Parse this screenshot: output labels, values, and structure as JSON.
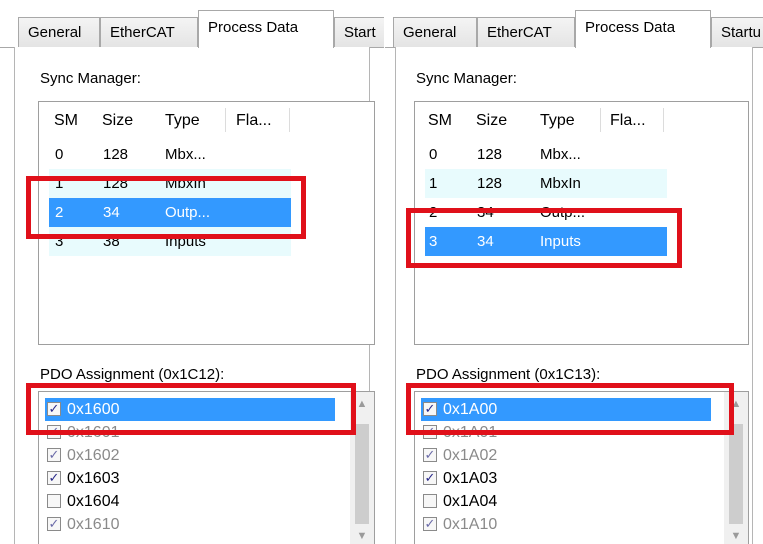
{
  "tabs": [
    "General",
    "EtherCAT",
    "Process Data",
    "Start",
    "Startu"
  ],
  "sync_manager_label": "Sync Manager:",
  "columns": [
    "SM",
    "Size",
    "Type",
    "Fla..."
  ],
  "left": {
    "sm_rows": [
      {
        "sm": "0",
        "size": "128",
        "type": "Mbx..."
      },
      {
        "sm": "1",
        "size": "128",
        "type": "MbxIn"
      },
      {
        "sm": "2",
        "size": "34",
        "type": "Outp..."
      },
      {
        "sm": "3",
        "size": "38",
        "type": "Inputs"
      }
    ],
    "pdo_label": "PDO Assignment (0x1C12):",
    "pdo_items": [
      "0x1600",
      "0x1601",
      "0x1602",
      "0x1603",
      "0x1604",
      "0x1610"
    ]
  },
  "right": {
    "sm_rows": [
      {
        "sm": "0",
        "size": "128",
        "type": "Mbx..."
      },
      {
        "sm": "1",
        "size": "128",
        "type": "MbxIn"
      },
      {
        "sm": "2",
        "size": "34",
        "type": "Outp..."
      },
      {
        "sm": "3",
        "size": "34",
        "type": "Inputs"
      }
    ],
    "pdo_label": "PDO Assignment (0x1C13):",
    "pdo_items": [
      "0x1A00",
      "0x1A01",
      "0x1A02",
      "0x1A03",
      "0x1A04",
      "0x1A10"
    ]
  },
  "scroll_up": "▲",
  "scroll_down": "▼",
  "check_glyph": "✓",
  "colors": {
    "selection": "#3399ff",
    "highlight_box": "#e0101a",
    "alt_row": "#e8fbfd"
  }
}
